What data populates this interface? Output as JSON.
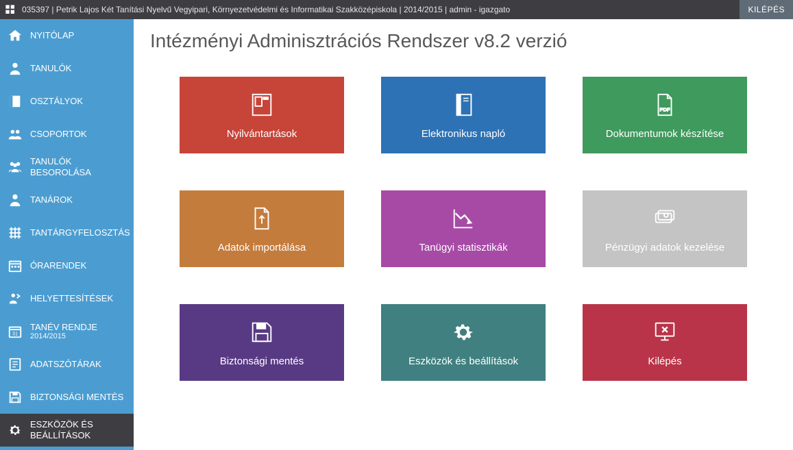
{
  "topbar": {
    "text": "035397 | Petrik Lajos Két Tanítási Nyelvű Vegyipari, Környezetvédelmi és Informatikai Szakközépiskola | 2014/2015 |  admin - igazgato",
    "logout": "KILÉPÉS"
  },
  "sidebar": {
    "items": [
      {
        "label": "NYITÓLAP"
      },
      {
        "label": "TANULÓK"
      },
      {
        "label": "OSZTÁLYOK"
      },
      {
        "label": "CSOPORTOK"
      },
      {
        "label": "TANULÓK BESOROLÁSA"
      },
      {
        "label": "TANÁROK"
      },
      {
        "label": "TANTÁRGYFELOSZTÁS"
      },
      {
        "label": "ÓRARENDEK"
      },
      {
        "label": "HELYETTESÍTÉSEK"
      },
      {
        "label": "TANÉV RENDJE",
        "sublabel": "2014/2015"
      },
      {
        "label": "ADATSZÓTÁRAK"
      },
      {
        "label": "BIZTONSÁGI MENTÉS"
      },
      {
        "label": "ESZKÖZÖK ÉS BEÁLLÍTÁSOK"
      }
    ]
  },
  "main": {
    "title": "Intézményi Adminisztrációs Rendszer v8.2 verzió",
    "tiles": [
      {
        "label": "Nyilvántartások",
        "color": "c-red",
        "icon": "records-icon"
      },
      {
        "label": "Elektronikus napló",
        "color": "c-blue",
        "icon": "journal-icon"
      },
      {
        "label": "Dokumentumok készítése",
        "color": "c-green",
        "icon": "pdf-icon"
      },
      {
        "label": "Adatok importálása",
        "color": "c-orange",
        "icon": "import-icon"
      },
      {
        "label": "Tanügyi statisztikák",
        "color": "c-purple",
        "icon": "stats-icon"
      },
      {
        "label": "Pénzügyi adatok kezelése",
        "color": "c-gray",
        "icon": "money-icon",
        "disabled": true
      },
      {
        "label": "Biztonsági mentés",
        "color": "c-dpurple",
        "icon": "save-icon"
      },
      {
        "label": "Eszközök és beállítások",
        "color": "c-teal",
        "icon": "gear-icon"
      },
      {
        "label": "Kilépés",
        "color": "c-darkred",
        "icon": "exit-icon"
      }
    ]
  }
}
